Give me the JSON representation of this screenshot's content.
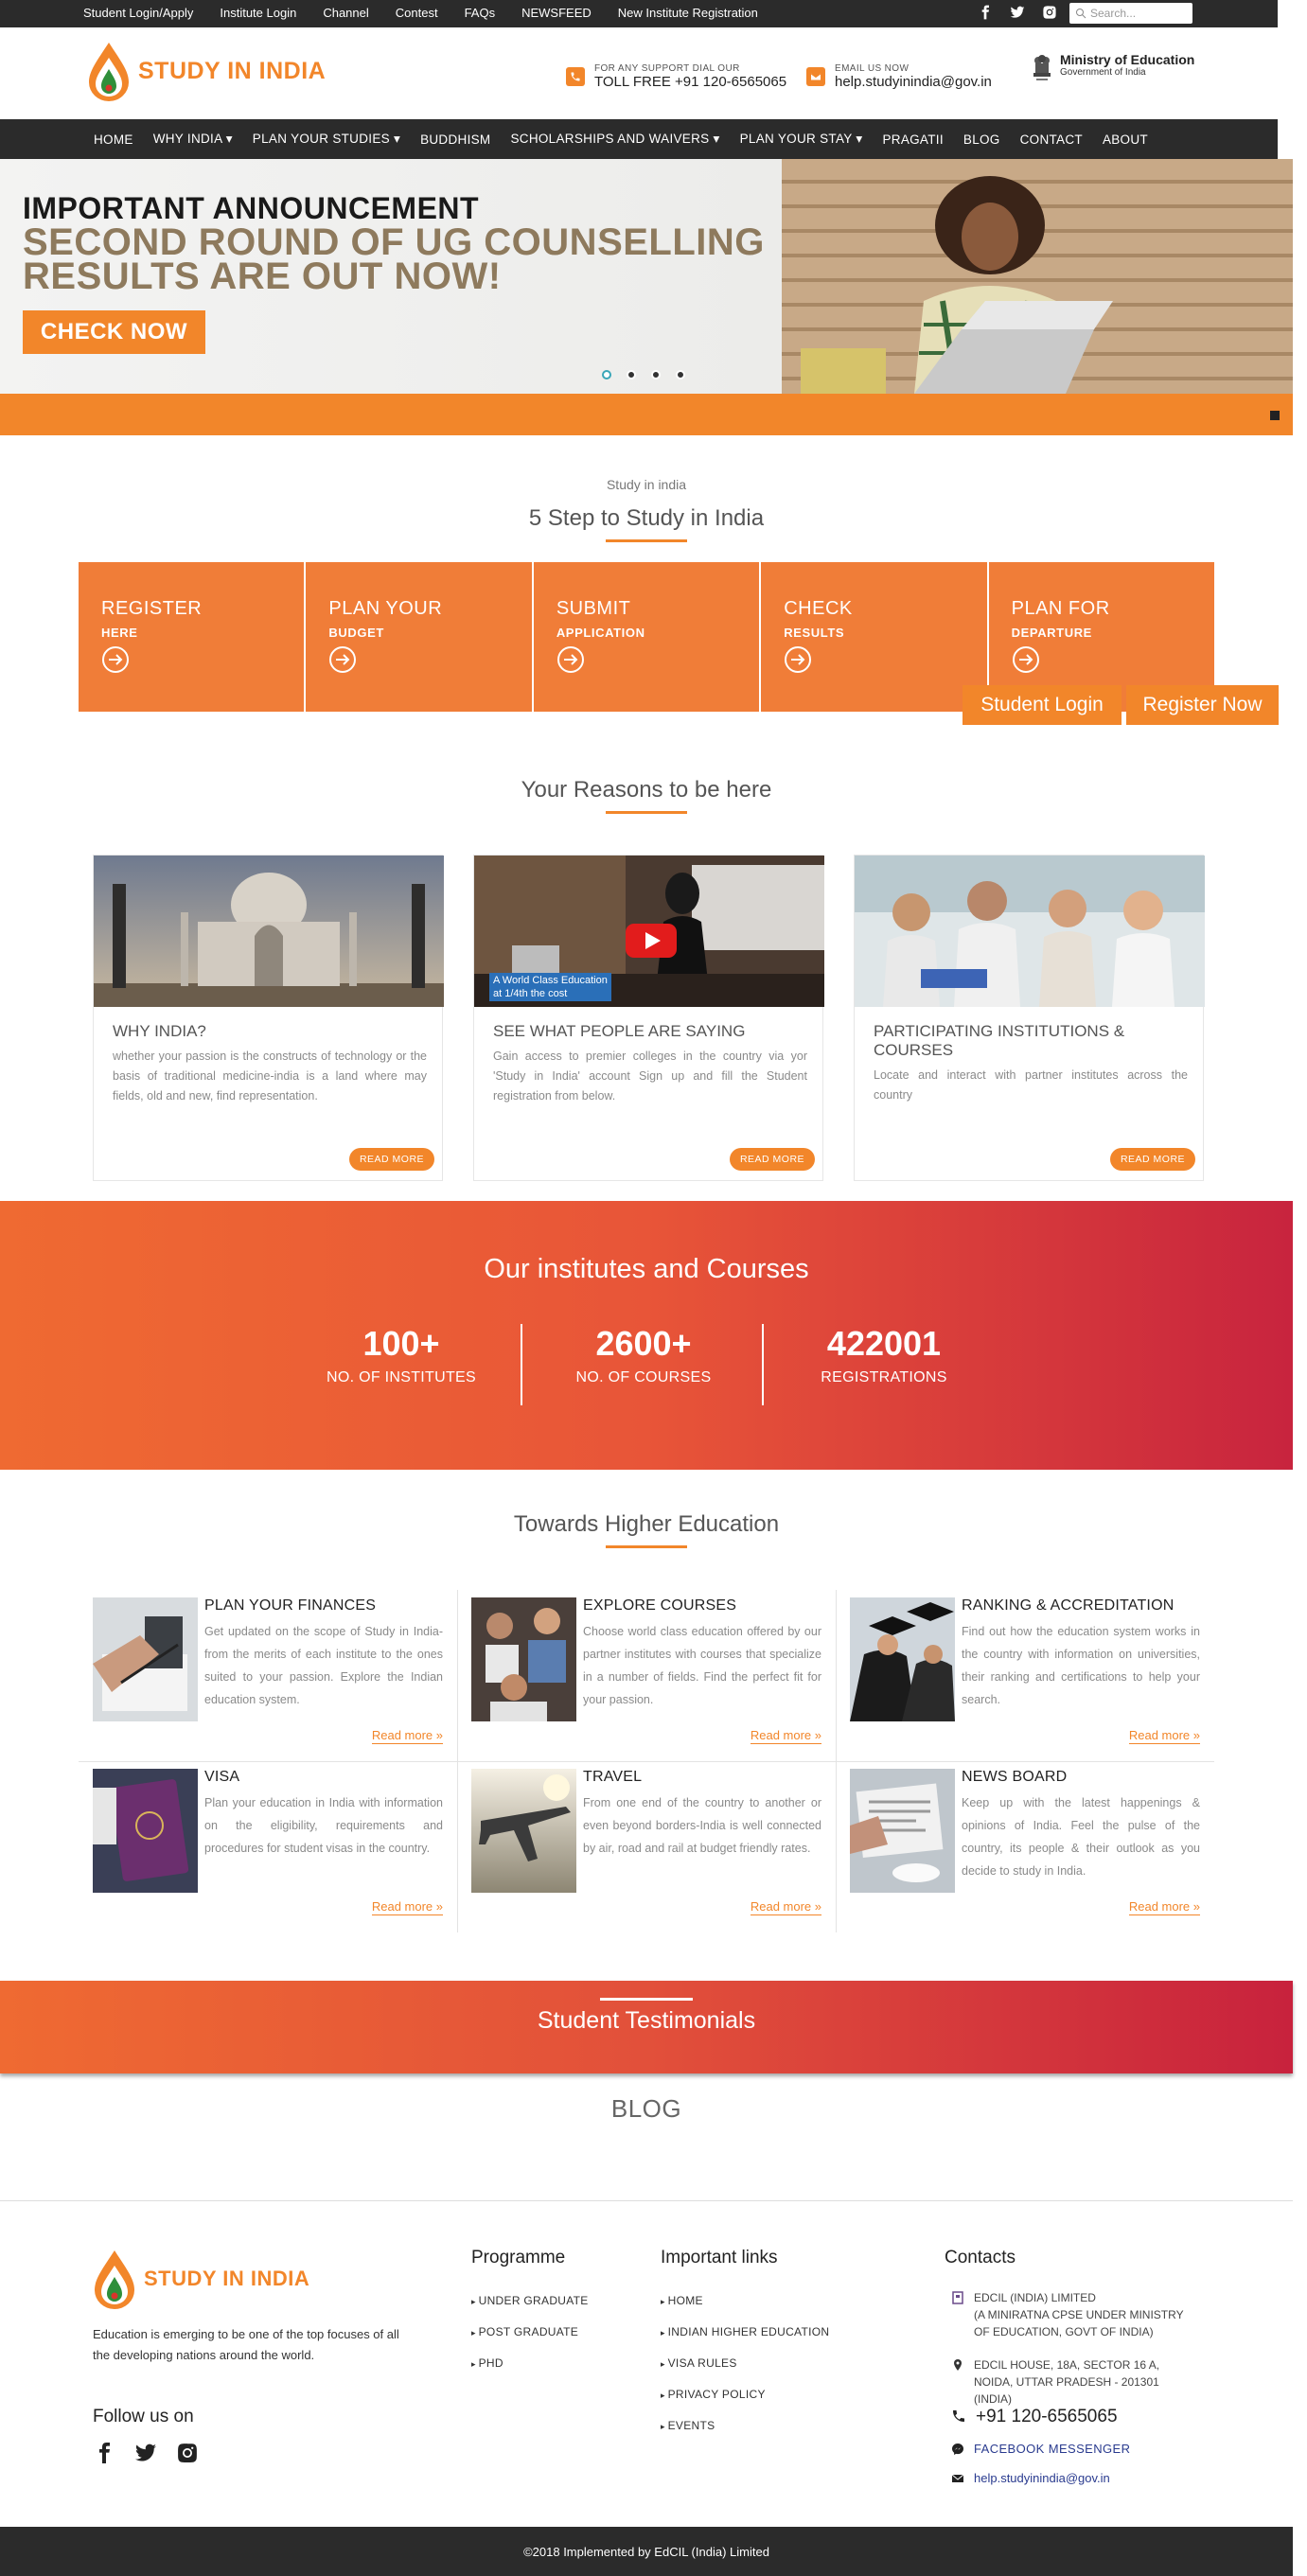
{
  "topbar": {
    "links": [
      "Student Login/Apply",
      "Institute Login",
      "Channel",
      "Contest",
      "FAQs",
      "NEWSFEED",
      "New Institute Registration"
    ],
    "search_placeholder": "Search..."
  },
  "header": {
    "logo_text": "STUDY IN INDIA",
    "support_small": "FOR ANY SUPPORT DIAL OUR",
    "support_big": "TOLL FREE +91 120-6565065",
    "email_small": "EMAIL US NOW",
    "email_big": "help.studyinindia@gov.in",
    "ministry_title": "Ministry of Education",
    "ministry_sub": "Government of India"
  },
  "nav": [
    "HOME",
    "WHY INDIA ▾",
    "PLAN YOUR STUDIES ▾",
    "BUDDHISM",
    "SCHOLARSHIPS AND WAIVERS ▾",
    "PLAN YOUR STAY ▾",
    "PRAGATII",
    "BLOG",
    "CONTACT",
    "ABOUT"
  ],
  "hero": {
    "line1": "IMPORTANT ANNOUNCEMENT",
    "line2": "SECOND ROUND OF UG COUNSELLING",
    "line3": "RESULTS ARE OUT NOW!",
    "cta": "CHECK NOW",
    "slide_count": 4,
    "active_slide": 1
  },
  "steps_section": {
    "subtitle": "Study in india",
    "title": "5 Step to Study in India",
    "steps": [
      {
        "title": "REGISTER",
        "sub": "HERE"
      },
      {
        "title": "PLAN YOUR",
        "sub": "BUDGET"
      },
      {
        "title": "SUBMIT",
        "sub": "APPLICATION"
      },
      {
        "title": "CHECK",
        "sub": "RESULTS"
      },
      {
        "title": "PLAN FOR",
        "sub": "DEPARTURE"
      }
    ],
    "student_login": "Student Login",
    "register_now": "Register Now"
  },
  "reasons": {
    "title": "Your Reasons to be here",
    "cards": [
      {
        "title": "WHY INDIA?",
        "desc": "whether your passion is the constructs of technology or the basis of traditional medicine-india is a land where may fields, old and new, find representation.",
        "button": "READ MORE"
      },
      {
        "title": "SEE WHAT PEOPLE ARE SAYING",
        "desc": "Gain access to premier colleges in the country via yor 'Study in India' account Sign up and fill the Student registration from below.",
        "button": "READ MORE",
        "video_caption_1": "A World Class Education",
        "video_caption_2": "at 1/4th the cost"
      },
      {
        "title": "PARTICIPATING INSTITUTIONS & COURSES",
        "desc": "Locate and interact with partner institutes across the country",
        "button": "READ MORE"
      }
    ]
  },
  "stats": {
    "title": "Our institutes and Courses",
    "items": [
      {
        "number": "100+",
        "label": "NO. OF INSTITUTES"
      },
      {
        "number": "2600+",
        "label": "NO. OF COURSES"
      },
      {
        "number": "422001",
        "label": "REGISTRATIONS"
      }
    ]
  },
  "higher_ed": {
    "title": "Towards Higher Education",
    "items": [
      {
        "title": "PLAN YOUR FINANCES",
        "desc": "Get updated on the scope of Study in India-from the merits of each institute to the ones suited to your passion. Explore the Indian education system.",
        "link": "Read more »"
      },
      {
        "title": "EXPLORE COURSES",
        "desc": "Choose world class education offered by our partner institutes with courses that specialize in a number of fields. Find the perfect fit for your passion.",
        "link": "Read more »"
      },
      {
        "title": "RANKING & ACCREDITATION",
        "desc": "Find out how the education system works in the country with information on universities, their ranking and certifications to help your search.",
        "link": "Read more »"
      },
      {
        "title": "VISA",
        "desc": "Plan your education in India with information on the eligibility, requirements and procedures for student visas in the country.",
        "link": "Read more »"
      },
      {
        "title": "TRAVEL",
        "desc": "From one end of the country to another or even beyond borders-India is well connected by air, road and rail at budget friendly rates.",
        "link": "Read more »"
      },
      {
        "title": "NEWS BOARD",
        "desc": "Keep up with the latest happenings & opinions of India. Feel the pulse of the country, its people & their outlook as you decide to study in India.",
        "link": "Read more »"
      }
    ]
  },
  "testimonials_title": "Student Testimonials",
  "blog_title": "BLOG",
  "footer": {
    "logo_text": "STUDY IN INDIA",
    "desc": "Education is emerging to be one of the top focuses of all the developing nations around the world.",
    "follow": "Follow us on",
    "programme_title": "Programme",
    "programme": [
      "UNDER GRADUATE",
      "POST GRADUATE",
      "PHD"
    ],
    "links_title": "Important links",
    "links": [
      "HOME",
      "INDIAN HIGHER EDUCATION",
      "VISA RULES",
      "PRIVACY POLICY",
      "EVENTS"
    ],
    "contacts_title": "Contacts",
    "org_1": "EDCIL (INDIA) LIMITED",
    "org_2": "(A MINIRATNA CPSE UNDER MINISTRY OF EDUCATION, GOVT OF INDIA)",
    "address": "EDCIL HOUSE, 18A, SECTOR 16 A, NOIDA, UTTAR PRADESH - 201301 (INDIA)",
    "phone": "+91 120-6565065",
    "messenger": "FACEBOOK MESSENGER",
    "email": "help.studyinindia@gov.in",
    "copyright": "©2018 Implemented by EdCIL (India) Limited"
  },
  "colors": {
    "accent": "#f2862a",
    "dark": "#2b2b2b",
    "gradient_end": "#c8243e"
  }
}
